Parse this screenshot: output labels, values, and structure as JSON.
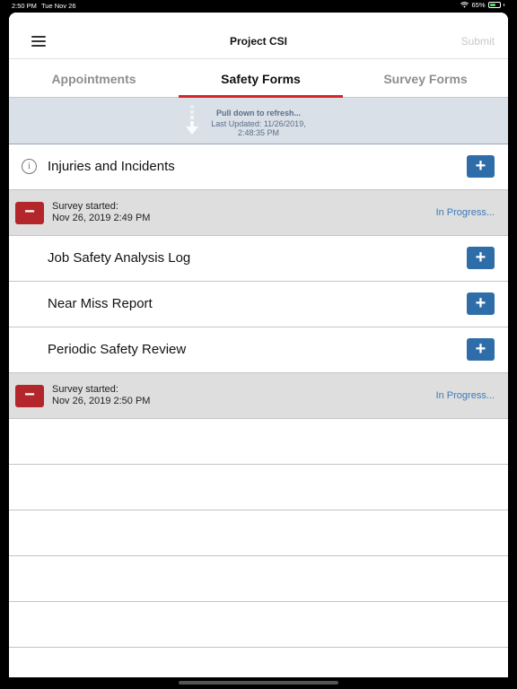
{
  "status_bar": {
    "time": "2:50 PM",
    "date": "Tue Nov 26",
    "battery": "65%"
  },
  "navbar": {
    "title": "Project CSI",
    "submit_label": "Submit"
  },
  "tabs": [
    {
      "label": "Appointments"
    },
    {
      "label": "Safety Forms"
    },
    {
      "label": "Survey Forms"
    }
  ],
  "refresh": {
    "title": "Pull down to refresh...",
    "line1": "Last Updated: 11/26/2019,",
    "line2": "2:48:35 PM"
  },
  "forms": [
    {
      "label": "Injuries and Incidents",
      "add": "+"
    },
    {
      "label": "Job Safety Analysis Log",
      "add": "+"
    },
    {
      "label": "Near Miss Report",
      "add": "+"
    },
    {
      "label": "Periodic Safety Review",
      "add": "+"
    }
  ],
  "surveys": [
    {
      "line1": "Survey started:",
      "line2": "Nov 26, 2019 2:49 PM",
      "status": "In Progress...",
      "remove": "−"
    },
    {
      "line1": "Survey started:",
      "line2": "Nov 26, 2019 2:50 PM",
      "status": "In Progress...",
      "remove": "−"
    }
  ],
  "colors": {
    "accent": "#d4252b",
    "add": "#2f6da8",
    "remove": "#b3262b",
    "link": "#3d7ab8"
  },
  "icons": {
    "info": "info-icon",
    "menu": "hamburger-menu-icon",
    "arrow": "pull-down-arrow-icon"
  }
}
